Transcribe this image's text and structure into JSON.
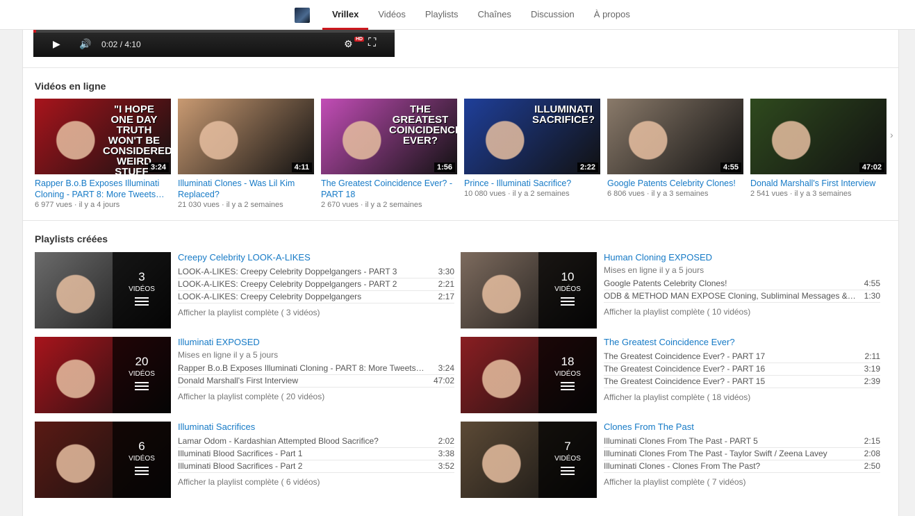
{
  "nav": {
    "tabs": [
      "Vrillex",
      "Vidéos",
      "Playlists",
      "Chaînes",
      "Discussion",
      "À propos"
    ],
    "active_index": 0
  },
  "player": {
    "time": "0:02 / 4:10",
    "hd_label": "HD",
    "progress_fraction": 0.008
  },
  "videos_section": {
    "title": "Vidéos en ligne",
    "items": [
      {
        "title": "Rapper B.o.B Exposes Illuminati Cloning - PART 8: More Tweets…",
        "views": "6 977 vues",
        "age": "il y a 4 jours",
        "duration": "3:24",
        "thumb_text": "\"I hope one day truth won't be considered weird stuff\"",
        "thumb_color": "#a8141c"
      },
      {
        "title": "Illuminati Clones - Was Lil Kim Replaced?",
        "views": "21 030 vues",
        "age": "il y a 2 semaines",
        "duration": "4:11",
        "thumb_text": "",
        "thumb_color": "#c99a72"
      },
      {
        "title": "The Greatest Coincidence Ever? - PART 18",
        "views": "2 670 vues",
        "age": "il y a 2 semaines",
        "duration": "1:56",
        "thumb_text": "The Greatest Coincidence Ever?",
        "thumb_color": "#c24db6"
      },
      {
        "title": "Prince - Illuminati Sacrifice?",
        "views": "10 080 vues",
        "age": "il y a 2 semaines",
        "duration": "2:22",
        "thumb_text": "Illuminati Sacrifice?",
        "thumb_color": "#1f3f9a"
      },
      {
        "title": "Google Patents Celebrity Clones!",
        "views": "6 806 vues",
        "age": "il y a 3 semaines",
        "duration": "4:55",
        "thumb_text": "",
        "thumb_color": "#8a7a6a"
      },
      {
        "title": "Donald Marshall's First Interview",
        "views": "2 541 vues",
        "age": "il y a 3 semaines",
        "duration": "47:02",
        "thumb_text": "",
        "thumb_color": "#2f4a1e"
      }
    ]
  },
  "playlists_section": {
    "title": "Playlists créées",
    "items": [
      {
        "title": "Creepy Celebrity LOOK-A-LIKES",
        "subtitle": "",
        "count": "3",
        "count_label": "VIDÉOS",
        "thumb_color": "#6b6b6b",
        "entries": [
          {
            "title": "LOOK-A-LIKES: Creepy Celebrity Doppelgangers - PART 3",
            "duration": "3:30"
          },
          {
            "title": "LOOK-A-LIKES: Creepy Celebrity Doppelgangers - PART 2",
            "duration": "2:21"
          },
          {
            "title": "LOOK-A-LIKES: Creepy Celebrity Doppelgangers",
            "duration": "2:17"
          }
        ],
        "show_all": "Afficher la playlist complète ( 3 vidéos)"
      },
      {
        "title": "Human Cloning EXPOSED",
        "subtitle": "Mises en ligne il y a 5 jours",
        "count": "10",
        "count_label": "VIDÉOS",
        "thumb_color": "#7d6b5e",
        "entries": [
          {
            "title": "Google Patents Celebrity Clones!",
            "duration": "4:55"
          },
          {
            "title": "ODB & METHOD MAN EXPOSE Cloning, Subliminal Messages &…",
            "duration": "1:30"
          }
        ],
        "show_all": "Afficher la playlist complète ( 10 vidéos)"
      },
      {
        "title": "Illuminati EXPOSED",
        "subtitle": "Mises en ligne il y a 5 jours",
        "count": "20",
        "count_label": "VIDÉOS",
        "thumb_color": "#a8141c",
        "entries": [
          {
            "title": "Rapper B.o.B Exposes Illuminati Cloning - PART 8: More Tweets…",
            "duration": "3:24"
          },
          {
            "title": "Donald Marshall's First Interview",
            "duration": "47:02"
          }
        ],
        "show_all": "Afficher la playlist complète ( 20 vidéos)"
      },
      {
        "title": "The Greatest Coincidence Ever?",
        "subtitle": "",
        "count": "18",
        "count_label": "VIDÉOS",
        "thumb_color": "#8a1e22",
        "entries": [
          {
            "title": "The Greatest Coincidence Ever? - PART 17",
            "duration": "2:11"
          },
          {
            "title": "The Greatest Coincidence Ever? - PART 16",
            "duration": "3:19"
          },
          {
            "title": "The Greatest Coincidence Ever? - PART 15",
            "duration": "2:39"
          }
        ],
        "show_all": "Afficher la playlist complète ( 18 vidéos)"
      },
      {
        "title": "Illuminati Sacrifices",
        "subtitle": "",
        "count": "6",
        "count_label": "VIDÉOS",
        "thumb_color": "#5a1a14",
        "entries": [
          {
            "title": "Lamar Odom - Kardashian Attempted Blood Sacrifice?",
            "duration": "2:02"
          },
          {
            "title": "Illuminati Blood Sacrifices - Part 1",
            "duration": "3:38"
          },
          {
            "title": "Illuminati Blood Sacrifices - Part 2",
            "duration": "3:52"
          }
        ],
        "show_all": "Afficher la playlist complète ( 6 vidéos)"
      },
      {
        "title": "Clones From The Past",
        "subtitle": "",
        "count": "7",
        "count_label": "VIDÉOS",
        "thumb_color": "#5c4a36",
        "entries": [
          {
            "title": "Illuminati Clones From The Past - PART 5",
            "duration": "2:15"
          },
          {
            "title": "Illuminati Clones From The Past - Taylor Swift / Zeena Lavey",
            "duration": "2:08"
          },
          {
            "title": "Illuminati Clones - Clones From The Past?",
            "duration": "2:50"
          }
        ],
        "show_all": "Afficher la playlist complète ( 7 vidéos)"
      }
    ]
  }
}
